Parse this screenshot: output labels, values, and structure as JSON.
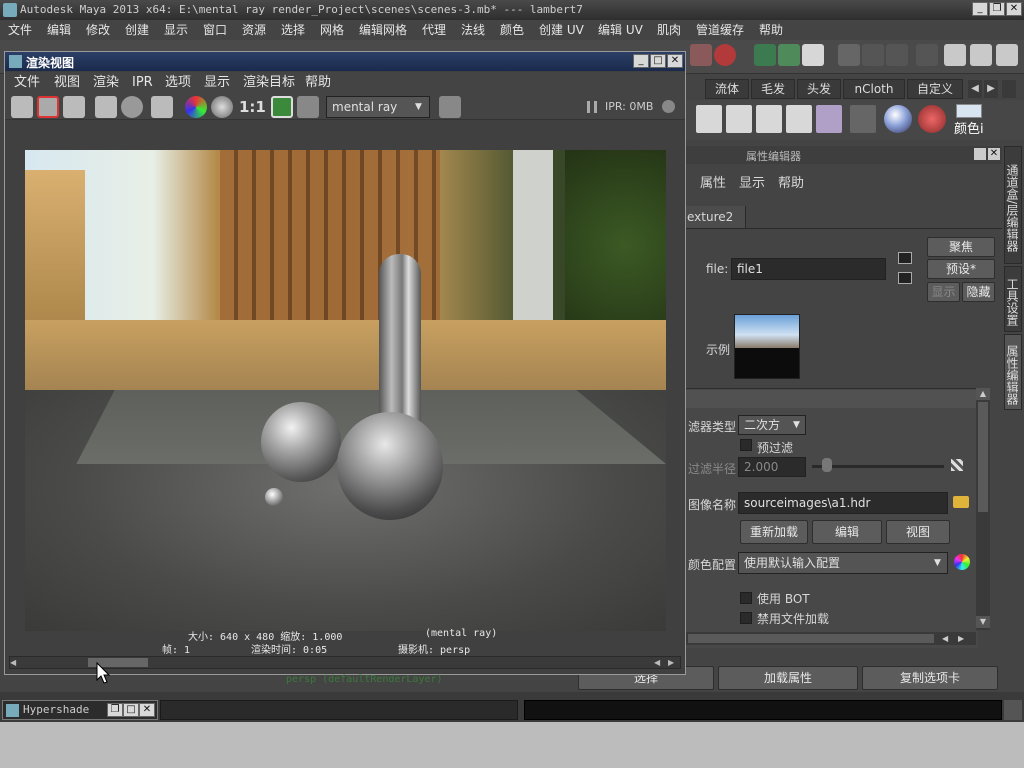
{
  "window": {
    "title": "Autodesk Maya 2013 x64: E:\\mental ray render_Project\\scenes\\scenes-3.mb*   ---   lambert7",
    "minimize": "_",
    "restore": "❐",
    "close": "✕"
  },
  "menubar": [
    "文件",
    "编辑",
    "修改",
    "创建",
    "显示",
    "窗口",
    "资源",
    "选择",
    "网格",
    "编辑网格",
    "代理",
    "法线",
    "颜色",
    "创建 UV",
    "编辑 UV",
    "肌肉",
    "管道缓存",
    "帮助"
  ],
  "shelf_tabs": [
    "流体",
    "毛发",
    "头发",
    "nCloth",
    "自定义"
  ],
  "shelf_extra_label": "颜色i",
  "attr_editor": {
    "title": "属性编辑器",
    "menu": [
      "属性",
      "显示",
      "帮助"
    ],
    "node_tab": "exture2",
    "file_label": "file:",
    "file_value": "file1",
    "focus_btn": "聚焦",
    "preset_btn": "预设*",
    "show_btn": "显示",
    "hide_btn": "隐藏",
    "sample_label": "示例",
    "filter_type_label": "滤器类型",
    "filter_type_value": "二次方",
    "prefilter_label": "预过滤",
    "filter_radius_label": "过滤半径",
    "filter_radius_value": "2.000",
    "image_name_label": "图像名称",
    "image_name_value": "sourceimages\\a1.hdr",
    "reload_btn": "重新加载",
    "edit_btn": "编辑",
    "view_btn": "视图",
    "color_profile_label": "颜色配置",
    "color_profile_value": "使用默认输入配置",
    "use_bot_label": "使用 BOT",
    "disable_load_label": "禁用文件加载",
    "select_btn": "选择",
    "load_attr_btn": "加载属性",
    "copy_tab_btn": "复制选项卡"
  },
  "side_tabs": [
    "通道盒/层编辑器",
    "工具设置",
    "属性编辑器"
  ],
  "render_view": {
    "title": "渲染视图",
    "menu": [
      "文件",
      "视图",
      "渲染",
      "IPR",
      "选项",
      "显示",
      "渲染目标",
      "帮助"
    ],
    "ratio": "1:1",
    "renderer": "mental ray",
    "ipr_status": "IPR: 0MB",
    "info_line1_size": "大小: 640 x 480 缩放: 1.000",
    "info_line1_renderer": "(mental ray)",
    "info_line2_frame": "帧: 1",
    "info_line2_time": "渲染时间: 0:05",
    "info_line2_camera": "摄影机: persp"
  },
  "bottom": {
    "hypershade_title": "Hypershade",
    "persp_text": "persp (defaultRenderLayer)"
  },
  "colors": {
    "title_blue": "#1f3157",
    "panel_bg": "#444444"
  }
}
